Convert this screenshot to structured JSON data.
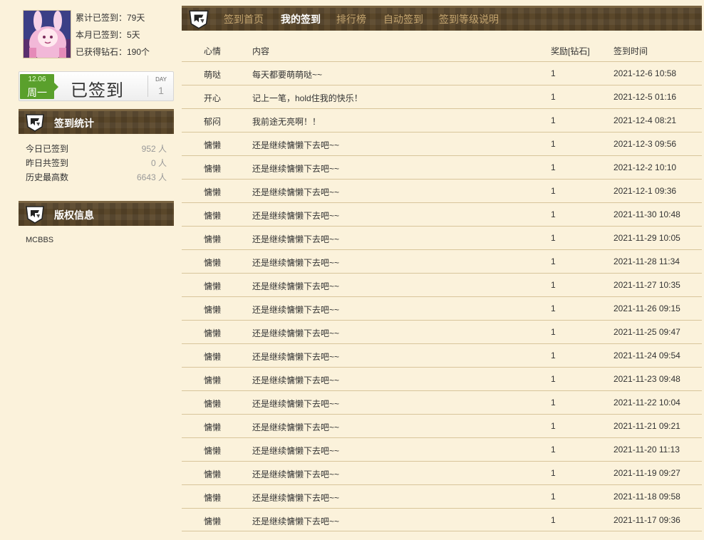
{
  "profile": {
    "total_days": "累计已签到：79天",
    "month_days": "本月已签到：5天",
    "diamonds": "已获得钻石：190个"
  },
  "checkin": {
    "date": "12.06",
    "weekday": "周一",
    "status": "已签到",
    "day_label": "DAY",
    "day_count": "1",
    "accent_color": "#5aa02c"
  },
  "stats_panel": {
    "title": "签到统计",
    "rows": [
      {
        "label": "今日已签到",
        "value": "952 人"
      },
      {
        "label": "昨日共签到",
        "value": "0 人"
      },
      {
        "label": "历史最高数",
        "value": "6643 人"
      }
    ]
  },
  "copyright_panel": {
    "title": "版权信息",
    "text": "MCBBS"
  },
  "nav": {
    "tabs": [
      {
        "label": "签到首页",
        "active": false
      },
      {
        "label": "我的签到",
        "active": true
      },
      {
        "label": "排行榜",
        "active": false
      },
      {
        "label": "自动签到",
        "active": false
      },
      {
        "label": "签到等级说明",
        "active": false
      }
    ],
    "header_color": "#5a472a",
    "inactive_tab_color": "#c3a46f"
  },
  "table": {
    "headers": {
      "mood": "心情",
      "content": "内容",
      "reward": "奖励[钻石]",
      "time": "签到时间"
    },
    "rows": [
      {
        "mood": "萌哒",
        "content": "每天都要萌萌哒~~",
        "reward": "1",
        "time": "2021-12-6 10:58"
      },
      {
        "mood": "开心",
        "content": "记上一笔，hold住我的快乐！",
        "reward": "1",
        "time": "2021-12-5 01:16"
      },
      {
        "mood": "郁闷",
        "content": "我前途无亮啊！！",
        "reward": "1",
        "time": "2021-12-4 08:21"
      },
      {
        "mood": "慵懒",
        "content": "还是继续慵懒下去吧~~",
        "reward": "1",
        "time": "2021-12-3 09:56"
      },
      {
        "mood": "慵懒",
        "content": "还是继续慵懒下去吧~~",
        "reward": "1",
        "time": "2021-12-2 10:10"
      },
      {
        "mood": "慵懒",
        "content": "还是继续慵懒下去吧~~",
        "reward": "1",
        "time": "2021-12-1 09:36"
      },
      {
        "mood": "慵懒",
        "content": "还是继续慵懒下去吧~~",
        "reward": "1",
        "time": "2021-11-30 10:48"
      },
      {
        "mood": "慵懒",
        "content": "还是继续慵懒下去吧~~",
        "reward": "1",
        "time": "2021-11-29 10:05"
      },
      {
        "mood": "慵懒",
        "content": "还是继续慵懒下去吧~~",
        "reward": "1",
        "time": "2021-11-28 11:34"
      },
      {
        "mood": "慵懒",
        "content": "还是继续慵懒下去吧~~",
        "reward": "1",
        "time": "2021-11-27 10:35"
      },
      {
        "mood": "慵懒",
        "content": "还是继续慵懒下去吧~~",
        "reward": "1",
        "time": "2021-11-26 09:15"
      },
      {
        "mood": "慵懒",
        "content": "还是继续慵懒下去吧~~",
        "reward": "1",
        "time": "2021-11-25 09:47"
      },
      {
        "mood": "慵懒",
        "content": "还是继续慵懒下去吧~~",
        "reward": "1",
        "time": "2021-11-24 09:54"
      },
      {
        "mood": "慵懒",
        "content": "还是继续慵懒下去吧~~",
        "reward": "1",
        "time": "2021-11-23 09:48"
      },
      {
        "mood": "慵懒",
        "content": "还是继续慵懒下去吧~~",
        "reward": "1",
        "time": "2021-11-22 10:04"
      },
      {
        "mood": "慵懒",
        "content": "还是继续慵懒下去吧~~",
        "reward": "1",
        "time": "2021-11-21 09:21"
      },
      {
        "mood": "慵懒",
        "content": "还是继续慵懒下去吧~~",
        "reward": "1",
        "time": "2021-11-20 11:13"
      },
      {
        "mood": "慵懒",
        "content": "还是继续慵懒下去吧~~",
        "reward": "1",
        "time": "2021-11-19 09:27"
      },
      {
        "mood": "慵懒",
        "content": "还是继续慵懒下去吧~~",
        "reward": "1",
        "time": "2021-11-18 09:58"
      },
      {
        "mood": "慵懒",
        "content": "还是继续慵懒下去吧~~",
        "reward": "1",
        "time": "2021-11-17 09:36"
      }
    ]
  }
}
